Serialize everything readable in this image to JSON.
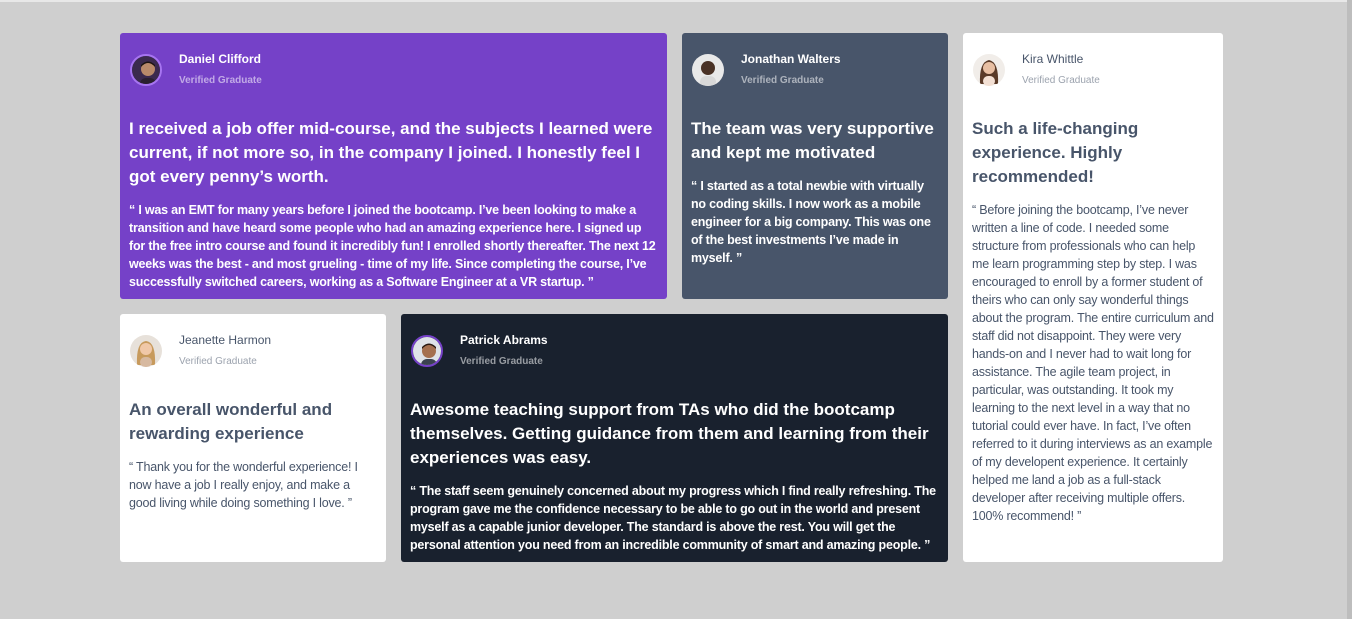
{
  "colors": {
    "background": "#cfcfcf",
    "purple": "#7541c8",
    "grayish_blue": "#48556a",
    "dark_blue": "#19212e",
    "white": "#ffffff"
  },
  "testimonials": [
    {
      "name": "Daniel Clifford",
      "role": "Verified Graduate",
      "avatar_icon": "avatar-daniel",
      "headline": "I received a job offer mid-course, and the subjects I learned were current, if not more so, in the company I joined. I honestly feel I got every penny’s worth.",
      "quote": "“ I was an EMT for many years before I joined the bootcamp. I’ve been looking to make a transition and have heard some people who had an amazing experience here. I signed up for the free intro course and found it incredibly fun! I enrolled shortly thereafter. The next 12 weeks was the best - and most grueling - time of my life. Since completing the course, I’ve successfully switched careers, working as a Software Engineer at a VR startup. ”"
    },
    {
      "name": "Jonathan Walters",
      "role": "Verified Graduate",
      "avatar_icon": "avatar-jonathan",
      "headline": "The team was very supportive and kept me motivated",
      "quote": "“ I started as a total newbie with virtually no coding skills. I now work as a mobile engineer for a big company. This was one of the best investments I’ve made in myself. ”"
    },
    {
      "name": "Kira Whittle",
      "role": "Verified Graduate",
      "avatar_icon": "avatar-kira",
      "headline": "Such a life-changing experience. Highly recommended!",
      "quote": "“ Before joining the bootcamp, I’ve never written a line of code. I needed some structure from professionals who can help me learn programming step by step. I was encouraged to enroll by a former student of theirs who can only say wonderful things about the program. The entire curriculum and staff did not disappoint. They were very hands-on and I never had to wait long for assistance. The agile team project, in particular, was outstanding. It took my learning to the next level in a way that no tutorial could ever have. In fact, I’ve often referred to it during interviews as an example of my developent experience. It certainly helped me land a job as a full-stack developer after receiving multiple offers. 100% recommend! ”"
    },
    {
      "name": "Jeanette Harmon",
      "role": "Verified Graduate",
      "avatar_icon": "avatar-jeanette",
      "headline": "An overall wonderful and rewarding experience",
      "quote": "“ Thank you for the wonderful experience! I now have a job I really enjoy, and make a good living while doing something I love. ”"
    },
    {
      "name": "Patrick Abrams",
      "role": "Verified Graduate",
      "avatar_icon": "avatar-patrick",
      "headline": "Awesome teaching support from TAs who did the bootcamp themselves. Getting guidance from them and learning from their experiences was easy.",
      "quote": "“ The staff seem genuinely concerned about my progress which I find really refreshing. The program gave me the confidence necessary to be able to go out in the world and present myself as a capable junior developer. The standard is above the rest. You will get the personal attention you need from an incredible community of smart and amazing people. ”"
    }
  ]
}
